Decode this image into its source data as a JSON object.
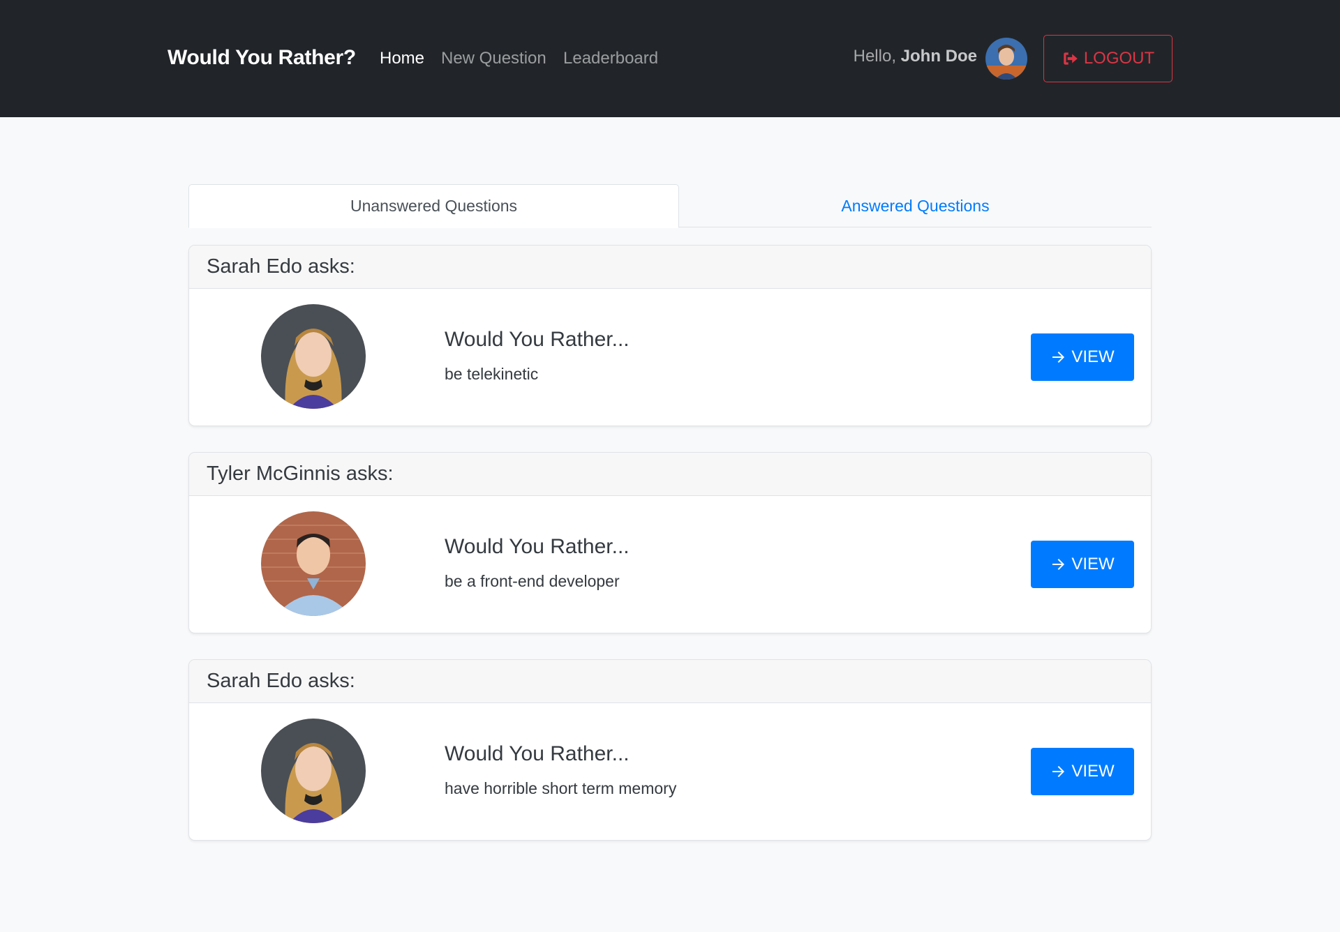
{
  "navbar": {
    "brand": "Would You Rather?",
    "links": [
      {
        "label": "Home",
        "active": true
      },
      {
        "label": "New Question",
        "active": false
      },
      {
        "label": "Leaderboard",
        "active": false
      }
    ],
    "greeting_prefix": "Hello,",
    "user_name": "John Doe",
    "logout_label": "LOGOUT"
  },
  "tabs": {
    "unanswered": "Unanswered Questions",
    "answered": "Answered Questions"
  },
  "questions": [
    {
      "header": "Sarah Edo asks:",
      "title": "Would You Rather...",
      "option": "be telekinetic",
      "button": "VIEW",
      "avatar": "sarah-avatar"
    },
    {
      "header": "Tyler McGinnis asks:",
      "title": "Would You Rather...",
      "option": "be a front-end developer",
      "button": "VIEW",
      "avatar": "tyler-avatar"
    },
    {
      "header": "Sarah Edo asks:",
      "title": "Would You Rather...",
      "option": "have horrible short term memory",
      "button": "VIEW",
      "avatar": "sarah-avatar"
    }
  ],
  "colors": {
    "navbar_bg": "#212529",
    "primary": "#007bff",
    "danger": "#dc3545",
    "page_bg": "#f8f9fa"
  }
}
